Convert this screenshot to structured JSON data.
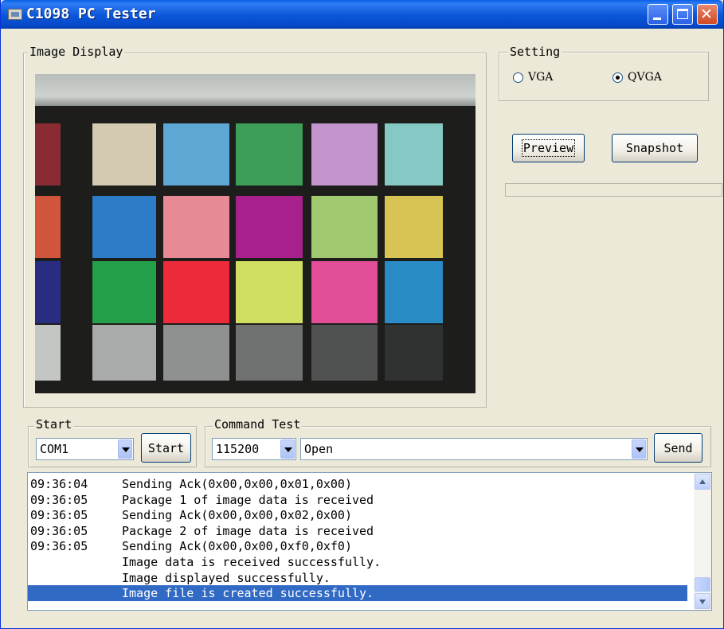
{
  "window": {
    "title": "C1098 PC Tester"
  },
  "image_display": {
    "legend": "Image Display",
    "patches": [
      [
        "#8a2b34",
        "#d4c9b1",
        "#5ea6d3",
        "#3e9d59",
        "#c395cc",
        "#86c8c4"
      ],
      [
        "#d1553a",
        "#2d7cc7",
        "#e88a95",
        "#a8208b",
        "#a1ca70",
        "#d8c454"
      ],
      [
        "#282d82",
        "#25a04a",
        "#ec2a3a",
        "#d0df62",
        "#e14d97",
        "#2a8bc5"
      ],
      [
        "#c4c6c4",
        "#a8aba9",
        "#8e918f",
        "#6f7270",
        "#4f5250",
        "#2f3230"
      ]
    ]
  },
  "setting": {
    "legend": "Setting",
    "options": [
      {
        "label": "VGA",
        "selected": false
      },
      {
        "label": "QVGA",
        "selected": true
      }
    ]
  },
  "actions": {
    "preview": "Preview",
    "snapshot": "Snapshot",
    "progress": 0.0
  },
  "start": {
    "legend": "Start",
    "port": "COM1",
    "start_label": "Start"
  },
  "command": {
    "legend": "Command Test",
    "baud": "115200",
    "command": "Open",
    "send_label": "Send"
  },
  "log": [
    {
      "time": "09:36:04",
      "msg": "Sending Ack(0x00,0x00,0x01,0x00)"
    },
    {
      "time": "09:36:05",
      "msg": "Package 1 of image data is received"
    },
    {
      "time": "09:36:05",
      "msg": "Sending Ack(0x00,0x00,0x02,0x00)"
    },
    {
      "time": "09:36:05",
      "msg": "Package 2 of image data is received"
    },
    {
      "time": "09:36:05",
      "msg": "Sending Ack(0x00,0x00,0xf0,0xf0)"
    },
    {
      "time": "",
      "msg": "Image data is received successfully."
    },
    {
      "time": "",
      "msg": "Image displayed successfully."
    },
    {
      "time": "",
      "msg": "Image file is created successfully.",
      "selected": true
    }
  ]
}
